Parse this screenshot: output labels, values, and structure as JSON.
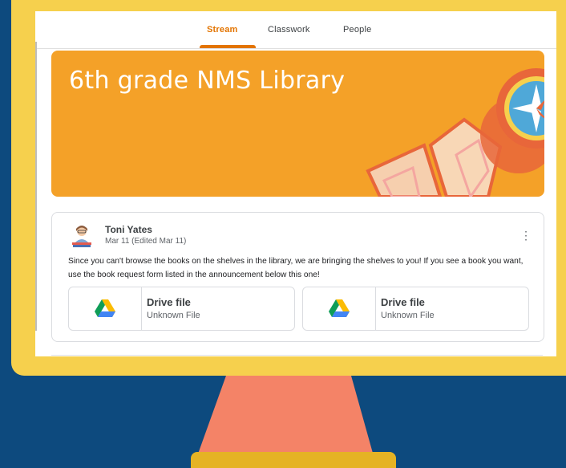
{
  "colors": {
    "background": "#0d4a7e",
    "monitor": "#f6d04d",
    "stand": "#f48367",
    "base": "#e5b324",
    "accent": "#e37400",
    "banner": "#f4a128"
  },
  "tabs": [
    {
      "label": "Stream",
      "active": true
    },
    {
      "label": "Classwork",
      "active": false
    },
    {
      "label": "People",
      "active": false
    }
  ],
  "banner": {
    "title": "6th grade NMS Library",
    "art_icon": "compass-and-map-illustration"
  },
  "post": {
    "author": "Toni Yates",
    "date": "Mar 11 (Edited Mar 11)",
    "avatar_icon": "reader-avatar-icon",
    "menu_icon": "more-vert-icon",
    "text": "Since you can't browse the books on the shelves in the library, we are bringing the shelves to you! If you see a book you want, use the book request form listed in the announcement below this one!",
    "attachments": [
      {
        "icon": "google-drive-icon",
        "title": "Drive file",
        "subtitle": "Unknown File"
      },
      {
        "icon": "google-drive-icon",
        "title": "Drive file",
        "subtitle": "Unknown File"
      }
    ]
  }
}
